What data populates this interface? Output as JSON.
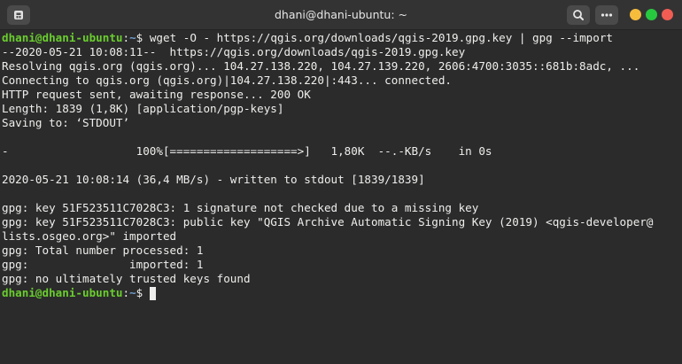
{
  "window": {
    "title": "dhani@dhani-ubuntu: ~"
  },
  "colors": {
    "prompt_user": "#6acd2f",
    "prompt_path": "#729fcf",
    "text": "#eeeeec",
    "background": "#2b2b2b",
    "close": "#f15d53",
    "maximize": "#27c93f",
    "minimize": "#f6bc3c"
  },
  "icons": {
    "new_tab": "terminal-new-tab-icon",
    "search": "search-icon",
    "menu": "ellipsis-icon"
  },
  "prompt": {
    "user_host": "dhani@dhani-ubuntu",
    "path": "~",
    "symbol": "$ "
  },
  "terminal": {
    "command": "wget -O - https://qgis.org/downloads/qgis-2019.gpg.key | gpg --import",
    "output": [
      "--2020-05-21 10:08:11--  https://qgis.org/downloads/qgis-2019.gpg.key",
      "Resolving qgis.org (qgis.org)... 104.27.138.220, 104.27.139.220, 2606:4700:3035::681b:8adc, ...",
      "Connecting to qgis.org (qgis.org)|104.27.138.220|:443... connected.",
      "HTTP request sent, awaiting response... 200 OK",
      "Length: 1839 (1,8K) [application/pgp-keys]",
      "Saving to: ‘STDOUT’",
      "",
      "-                   100%[===================>]   1,80K  --.-KB/s    in 0s",
      "",
      "2020-05-21 10:08:14 (36,4 MB/s) - written to stdout [1839/1839]",
      "",
      "gpg: key 51F523511C7028C3: 1 signature not checked due to a missing key",
      "gpg: key 51F523511C7028C3: public key \"QGIS Archive Automatic Signing Key (2019) <qgis-developer@",
      "lists.osgeo.org>\" imported",
      "gpg: Total number processed: 1",
      "gpg:               imported: 1",
      "gpg: no ultimately trusted keys found"
    ]
  }
}
